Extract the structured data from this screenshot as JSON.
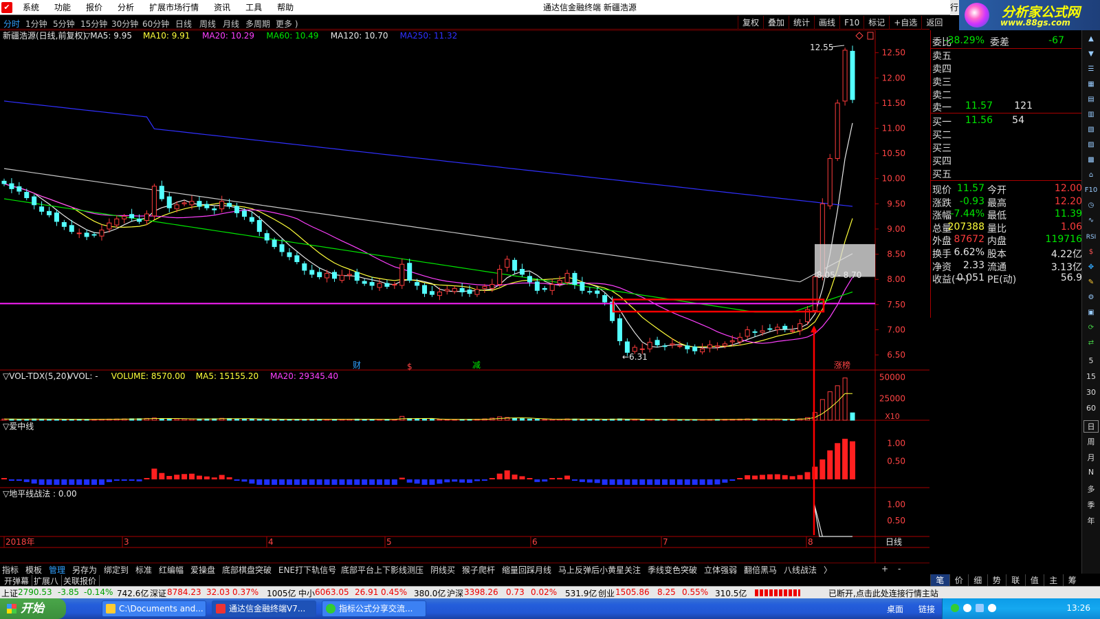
{
  "window": {
    "title": "通达信金融终端 新疆浩源",
    "menu": [
      "系统",
      "功能",
      "报价",
      "分析",
      "扩展市场行情",
      "资讯",
      "工具",
      "帮助"
    ],
    "tab_go": "行"
  },
  "logo": {
    "text": "分析家公式网",
    "url": "www.88gs.com"
  },
  "periods": [
    "分时",
    "1分钟",
    "5分钟",
    "15分钟",
    "30分钟",
    "60分钟",
    "日线",
    "周线",
    "月线",
    "多周期",
    "更多 )"
  ],
  "periods_active": 6,
  "tools": [
    "复权",
    "叠加",
    "统计",
    "画线",
    "F10",
    "标记",
    "+自选",
    "返回"
  ],
  "main_legend": {
    "name": "新疆浩源(日线,前复权)",
    "items": [
      {
        "label": "▽MA5: 9.95",
        "color": "#e8e8e8"
      },
      {
        "label": "MA10: 9.91",
        "color": "#ffff3a"
      },
      {
        "label": "MA20: 10.29",
        "color": "#ff40ff"
      },
      {
        "label": "MA60: 10.49",
        "color": "#00e600"
      },
      {
        "label": "MA120: 10.70",
        "color": "#e8e8e8"
      },
      {
        "label": "MA250: 11.32",
        "color": "#3030ff"
      }
    ]
  },
  "vol_legend": {
    "name": "▽VOL-TDX(5,20)",
    "items": [
      {
        "label": "VVOL: -",
        "color": "#e8e8e8"
      },
      {
        "label": "VOLUME: 8570.00",
        "color": "#ffff3a"
      },
      {
        "label": "MA5: 15155.20",
        "color": "#ffff3a"
      },
      {
        "label": "MA20: 29345.40",
        "color": "#ff40ff"
      }
    ]
  },
  "ind1_legend": "▽爱中线",
  "ind2_legend": "▽地平线战法 : 0.00",
  "price_axis": [
    "12.50",
    "12.00",
    "11.50",
    "11.00",
    "10.50",
    "10.00",
    "9.50",
    "9.00",
    "8.50",
    "8.00",
    "7.50",
    "7.00",
    "6.50"
  ],
  "vol_axis": [
    "50000",
    "25000"
  ],
  "vol_unit": "X10",
  "ind_axis": [
    "1.00",
    "0.50"
  ],
  "ind2_axis": [
    "1.00",
    "0.50"
  ],
  "date_axis": [
    "2018年",
    "3",
    "4",
    "5",
    "6",
    "7",
    "8"
  ],
  "date_label": "日线",
  "annotations": {
    "high": "12.55",
    "low": "←6.31",
    "range": "8.05 - 8.70",
    "markers": [
      "财",
      "$",
      "减",
      "涨榜"
    ]
  },
  "quote": {
    "weibi_label": "委比",
    "weibi_value": "-38.29%",
    "weicha_label": "委差",
    "weicha_value": "-67",
    "sells": [
      "卖五",
      "卖四",
      "卖三",
      "卖二",
      "卖一"
    ],
    "sell1_price": "11.57",
    "sell1_vol": "121",
    "buys": [
      "买一",
      "买二",
      "买三",
      "买四",
      "买五"
    ],
    "buy1_price": "11.56",
    "buy1_vol": "54",
    "rows": [
      {
        "l1": "现价",
        "v1": "11.57",
        "c1": "green",
        "l2": "今开",
        "v2": "12.00",
        "c2": "red"
      },
      {
        "l1": "涨跌",
        "v1": "-0.93",
        "c1": "green",
        "l2": "最高",
        "v2": "12.20",
        "c2": "red"
      },
      {
        "l1": "涨幅",
        "v1": "-7.44%",
        "c1": "green",
        "l2": "最低",
        "v2": "11.39",
        "c2": "green"
      },
      {
        "l1": "总量",
        "v1": "207388",
        "c1": "yellow",
        "l2": "量比",
        "v2": "1.06",
        "c2": "red"
      },
      {
        "l1": "外盘",
        "v1": "87672",
        "c1": "red",
        "l2": "内盘",
        "v2": "119716",
        "c2": "green"
      },
      {
        "l1": "换手",
        "v1": "6.62%",
        "c1": "white",
        "l2": "股本",
        "v2": "4.22亿",
        "c2": "white"
      },
      {
        "l1": "净资",
        "v1": "2.33",
        "c1": "white",
        "l2": "流通",
        "v2": "3.13亿",
        "c2": "white"
      },
      {
        "l1": "收益(一)",
        "v1": "0.051",
        "c1": "white",
        "l2": "PE(动)",
        "v2": "56.9",
        "c2": "white"
      }
    ]
  },
  "side_texts": [
    "5",
    "15",
    "30",
    "60",
    "日",
    "周",
    "月",
    "N",
    "多",
    "季",
    "年"
  ],
  "side_icons": [
    "RSI",
    "F10"
  ],
  "ind_tabs": [
    "指标",
    "模板",
    "管理",
    "另存为",
    "绑定到",
    "标准",
    "红编幅",
    "爱操盘",
    "底部棋盘突破",
    "ENE打下轨信号",
    "底部平台上下影线测压",
    "阴线买",
    "猴子爬杆",
    "缩量回踩月线",
    "马上反弹后小黄星关注",
    "季线变色突破",
    "立体强弱",
    "翻倍黑马",
    "八线战法",
    "〉"
  ],
  "ind_tabs_active": 2,
  "ind_tabs_right": [
    "+",
    "-"
  ],
  "sub_tabs": [
    "开弹幕",
    "扩展八",
    "关联报价"
  ],
  "right_tabs": [
    "笔",
    "价",
    "细",
    "势",
    "联",
    "值",
    "主",
    "筹"
  ],
  "status": {
    "sh_label": "上证",
    "sh_val": "2790.53",
    "sh_chg": "-3.85",
    "sh_pct": "-0.14%",
    "sh_amt": "742.6亿",
    "sz_label": "深证",
    "sz_val": "8784.23",
    "sz_chg": "32.03",
    "sz_pct": "0.37%",
    "sz_amt": "1005亿",
    "zx_label": "中小",
    "zx_val": "6063.05",
    "zx_chg": "26.91",
    "zx_pct": "0.45%",
    "zx_amt": "380.0亿",
    "hs_label": "沪深",
    "hs_val": "3398.26",
    "hs_chg": "0.73",
    "hs_pct": "0.02%",
    "hs_amt": "531.9亿",
    "cy_label": "创业",
    "cy_val": "1505.86",
    "cy_chg": "8.25",
    "cy_pct": "0.55%",
    "cy_amt": "310.5亿",
    "msg": "已断开,点击此处连接行情主站"
  },
  "taskbar": {
    "start": "开始",
    "tasks": [
      "C:\\Documents and...",
      "通达信金融终端V7...",
      "指标公式分享交流..."
    ],
    "tray_text": [
      "桌面",
      "链接"
    ],
    "clock": "13:26"
  },
  "chart_data": {
    "type": "candlestick",
    "title": "新疆浩源(日线,前复权)",
    "price_range": [
      6.2,
      12.7
    ],
    "highlight_price_line": 7.52,
    "high_label": 12.55,
    "low_label": 6.31,
    "box_range": [
      8.05,
      8.7
    ],
    "moving_averages": [
      {
        "name": "MA5",
        "value": 9.95
      },
      {
        "name": "MA10",
        "value": 9.91
      },
      {
        "name": "MA20",
        "value": 10.29
      },
      {
        "name": "MA60",
        "value": 10.49
      },
      {
        "name": "MA120",
        "value": 10.7
      },
      {
        "name": "MA250",
        "value": 11.32
      }
    ],
    "closes": [
      9.9,
      9.8,
      9.75,
      9.62,
      9.48,
      9.35,
      9.28,
      9.15,
      9.05,
      8.95,
      8.92,
      8.85,
      8.88,
      8.98,
      9.12,
      9.2,
      9.25,
      9.22,
      9.15,
      9.3,
      9.85,
      9.6,
      9.42,
      9.48,
      9.52,
      9.55,
      9.45,
      9.42,
      9.38,
      9.55,
      9.45,
      9.32,
      9.25,
      9.15,
      8.95,
      8.78,
      8.65,
      8.55,
      8.45,
      8.35,
      8.18,
      8.1,
      8.05,
      8.12,
      8.02,
      8.08,
      8.1,
      7.98,
      7.92,
      7.88,
      7.92,
      7.86,
      7.9,
      8.3,
      7.98,
      7.88,
      7.72,
      7.7,
      7.75,
      7.8,
      7.82,
      7.75,
      7.72,
      7.8,
      7.86,
      7.9,
      8.2,
      8.4,
      8.18,
      8.1,
      7.95,
      7.78,
      7.8,
      7.9,
      7.98,
      8.12,
      7.9,
      7.78,
      7.75,
      7.72,
      7.55,
      7.18,
      6.78,
      6.55,
      6.65,
      6.62,
      6.75,
      6.7,
      6.68,
      6.72,
      6.68,
      6.62,
      6.58,
      6.62,
      6.7,
      6.68,
      6.72,
      6.78,
      6.85,
      7.0,
      6.95,
      6.98,
      7.02,
      7.05,
      7.02,
      6.98,
      7.12,
      7.4,
      8.05,
      9.5,
      10.4,
      11.5,
      12.55,
      11.57
    ],
    "volumes": [
      1400,
      1300,
      1200,
      1100,
      1500,
      1300,
      1200,
      1100,
      1000,
      1100,
      1100,
      1000,
      1000,
      1200,
      1300,
      1400,
      1500,
      1700,
      1800,
      2100,
      2600,
      1900,
      1700,
      1600,
      1500,
      1400,
      1400,
      1500,
      1700,
      2200,
      1900,
      1600,
      1500,
      1400,
      1300,
      1200,
      1100,
      1000,
      1000,
      1100,
      1200,
      1200,
      1100,
      1000,
      1000,
      1100,
      1200,
      1300,
      1200,
      1000,
      1000,
      900,
      900,
      4500,
      2000,
      1500,
      1200,
      1100,
      1000,
      900,
      900,
      900,
      1000,
      1200,
      1500,
      2400,
      4000,
      3200,
      2500,
      1800,
      1400,
      1100,
      1000,
      1100,
      1200,
      1500,
      1400,
      1200,
      1100,
      1000,
      1100,
      1400,
      1600,
      1100,
      1000,
      1000,
      1000,
      900,
      900,
      900,
      800,
      800,
      800,
      800,
      900,
      900,
      1000,
      1100,
      1300,
      1500,
      1300,
      1200,
      1100,
      1300,
      1200,
      1100,
      1600,
      3000,
      9000,
      24000,
      33000,
      40000,
      49000,
      8570
    ]
  }
}
